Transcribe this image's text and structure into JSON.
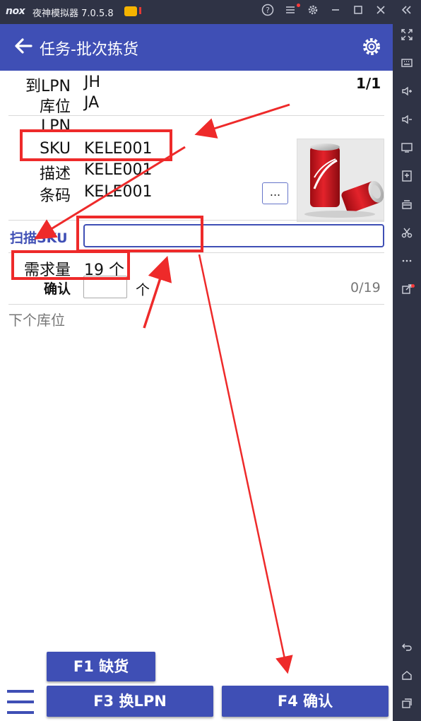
{
  "window": {
    "logo": "nox",
    "title": "夜神模拟器 7.0.5.8",
    "controls": [
      "help-icon",
      "menu-icon",
      "settings-icon",
      "minimize-icon",
      "maximize-icon",
      "close-icon",
      "collapse-icon"
    ]
  },
  "sidebar": {
    "icons": [
      "fullscreen-icon",
      "keyboard-icon",
      "volume-up-icon",
      "volume-down-icon",
      "screen-icon",
      "apk-install-icon",
      "stack-icon",
      "scissors-icon",
      "more-icon",
      "share-icon",
      "back-icon",
      "home-icon",
      "recent-apps-icon"
    ]
  },
  "app": {
    "title": "任务-批次拣货",
    "accent": "#3f4fb5",
    "counter": "1/1",
    "fields": {
      "to_lpn_label": "到LPN",
      "to_lpn_value": "JH",
      "location_label": "库位",
      "location_value": "JA",
      "lpn_label": "LPN",
      "lpn_value": "",
      "sku_label": "SKU",
      "sku_value": "KELE001",
      "desc_label": "描述",
      "desc_value": "KELE001",
      "barcode_label": "条码",
      "barcode_value": "KELE001"
    },
    "more_button": "...",
    "scan_label": "扫描SKU",
    "scan_value": "",
    "demand_label": "需求量",
    "demand_value": "19 个",
    "confirm_label": "确认",
    "confirm_value": "",
    "confirm_unit": "个",
    "confirm_progress": "0/19",
    "next_location_label": "下个库位",
    "next_location_value": ""
  },
  "buttons": {
    "f1": "F1 缺货",
    "f3": "F3 换LPN",
    "f4": "F4 确认"
  },
  "annotation_color": "#ee2a2a"
}
